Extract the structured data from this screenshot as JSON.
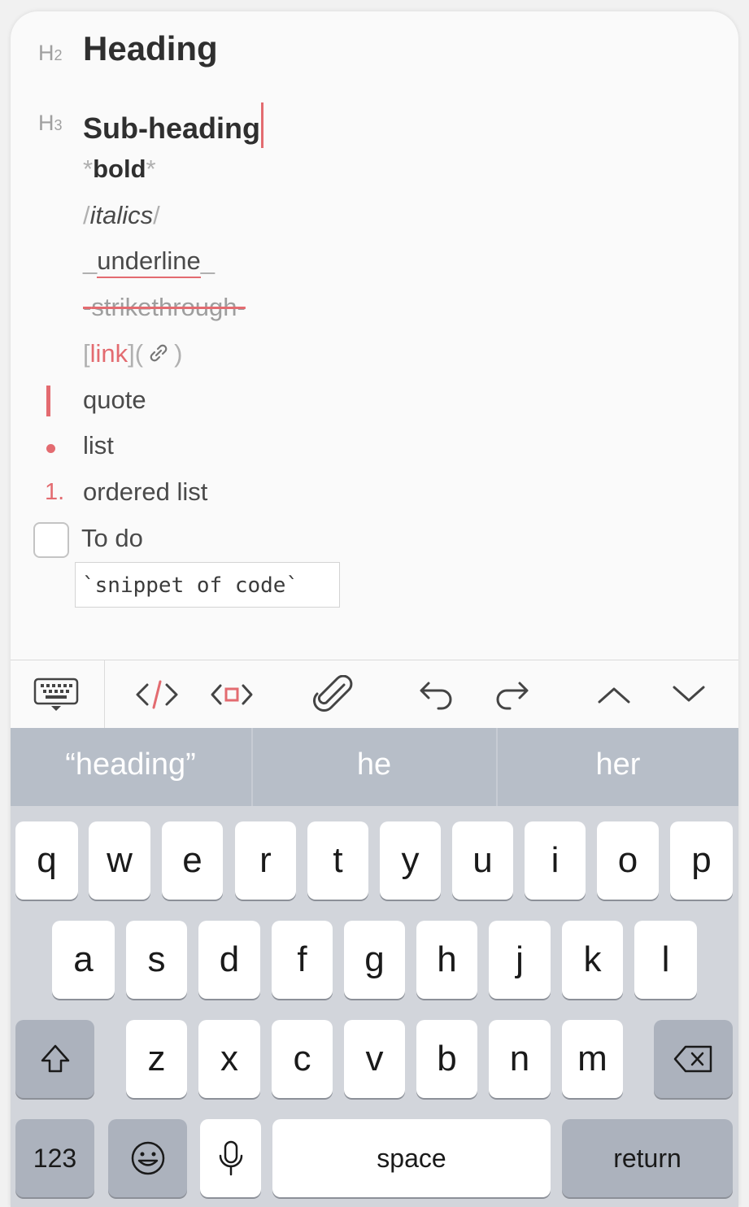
{
  "editor": {
    "h2": {
      "marker": "H",
      "level": "2",
      "text": "Heading"
    },
    "h3": {
      "marker": "H",
      "level": "3",
      "text": "Sub-heading"
    },
    "bold": {
      "open": "*",
      "text": "bold",
      "close": "*"
    },
    "italics": {
      "open": "/",
      "text": "italics",
      "close": "/"
    },
    "underline": {
      "open": "_",
      "text": "underline",
      "close": "_"
    },
    "strikethrough": {
      "open": "-",
      "text": "strikethrough",
      "close": "-"
    },
    "link": {
      "open": "[",
      "text": "link",
      "mid": "](",
      "close": ")"
    },
    "quote": "quote",
    "list": "list",
    "ordered": {
      "marker": "1.",
      "text": "ordered list"
    },
    "todo": "To do",
    "code": "`snippet of code`"
  },
  "toolbar": {
    "items": [
      "keyboard-icon",
      "code-icon",
      "embed-code-icon",
      "attachment-icon",
      "undo-icon",
      "redo-icon",
      "chevron-up-icon",
      "chevron-down-icon"
    ]
  },
  "suggestions": [
    "“heading”",
    "he",
    "her"
  ],
  "keyboard": {
    "row1": [
      "q",
      "w",
      "e",
      "r",
      "t",
      "y",
      "u",
      "i",
      "o",
      "p"
    ],
    "row2": [
      "a",
      "s",
      "d",
      "f",
      "g",
      "h",
      "j",
      "k",
      "l"
    ],
    "row3": [
      "z",
      "x",
      "c",
      "v",
      "b",
      "n",
      "m"
    ],
    "numbers": "123",
    "space": "space",
    "return": "return"
  },
  "colors": {
    "accent": "#e36b70",
    "keyboard_bg": "#d2d5db",
    "suggestion_bg": "#b7bec8"
  }
}
